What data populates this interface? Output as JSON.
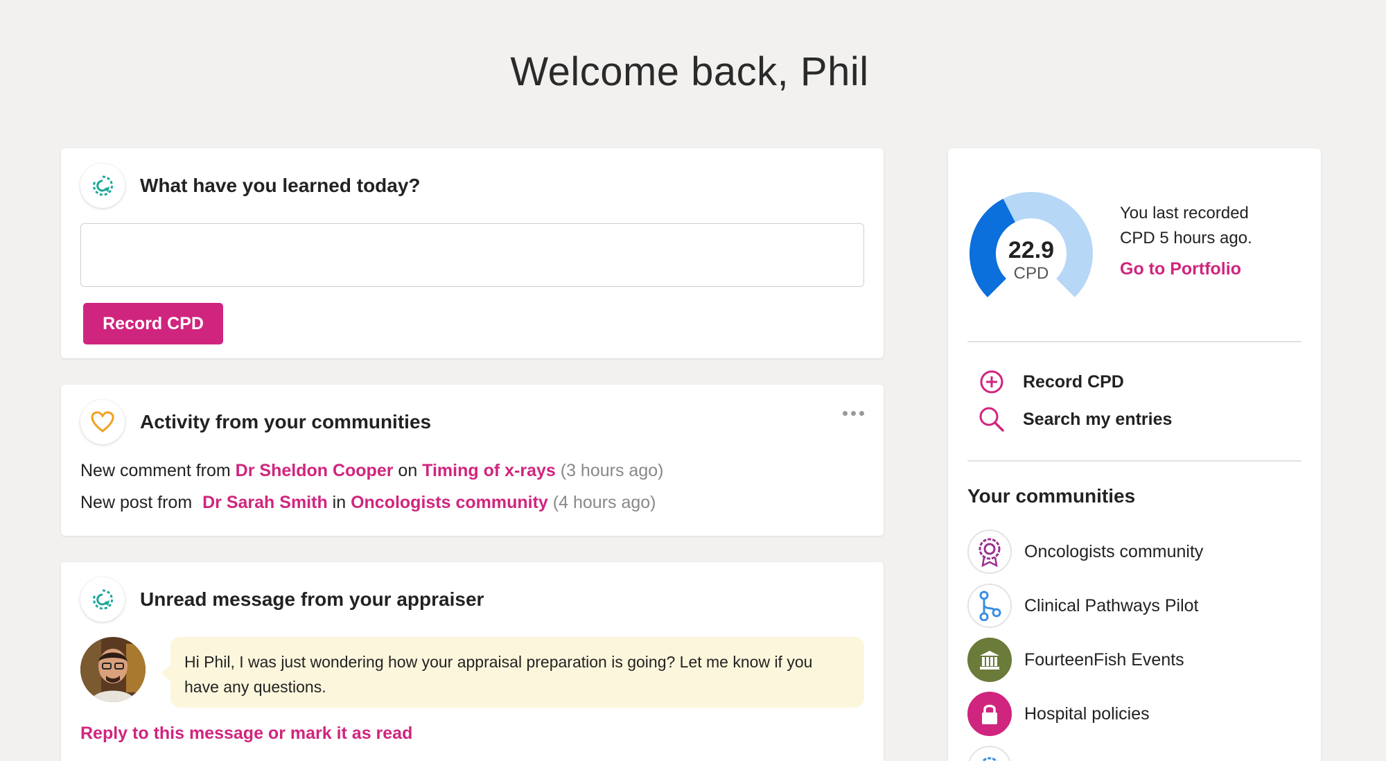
{
  "header": {
    "welcome": "Welcome back, Phil"
  },
  "learn_card": {
    "title": "What have you learned today?",
    "input_value": "",
    "button_label": "Record CPD"
  },
  "activity_card": {
    "title": "Activity from your communities",
    "items": [
      {
        "prefix": "New comment from ",
        "person": "Dr Sheldon Cooper",
        "joiner": " on ",
        "target": "Timing of x-rays",
        "time": " (3 hours ago)"
      },
      {
        "prefix": "New post from ",
        "person": "Dr Sarah Smith",
        "joiner": " in ",
        "target": "Oncologists community",
        "time": " (4 hours ago)"
      }
    ]
  },
  "message_card": {
    "title": "Unread message from your appraiser",
    "message": "Hi Phil, I was just wondering how your appraisal preparation is going? Let me know if you have any questions.",
    "reply_label": "Reply to this message or mark it as read"
  },
  "cpd_summary": {
    "value": "22.9",
    "unit": "CPD",
    "progress_fraction": 0.4,
    "last_recorded": "You last recorded CPD 5 hours ago.",
    "portfolio_link": "Go to Portfolio",
    "colors": {
      "filled": "#0b6fdc",
      "remaining": "#b6d7f6"
    }
  },
  "quick_actions": [
    {
      "label": "Record CPD",
      "icon": "plus-circle-icon"
    },
    {
      "label": "Search my entries",
      "icon": "search-icon"
    }
  ],
  "communities": {
    "title": "Your communities",
    "items": [
      {
        "name": "Oncologists community",
        "icon": "badge-icon"
      },
      {
        "name": "Clinical Pathways Pilot",
        "icon": "pathway-icon"
      },
      {
        "name": "FourteenFish Events",
        "icon": "building-icon"
      },
      {
        "name": "Hospital policies",
        "icon": "lock-icon"
      }
    ]
  },
  "colors": {
    "accent": "#d0257e",
    "teal": "#1aa89a",
    "orange": "#f0a020",
    "olive": "#6b7b3a"
  }
}
